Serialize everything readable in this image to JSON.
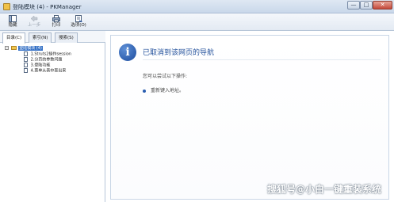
{
  "window": {
    "title": "登陆模块 (4) - PKManager",
    "minimize_glyph": "—",
    "maximize_glyph": "□",
    "close_glyph": "✕"
  },
  "toolbar": {
    "hide_label": "隐藏",
    "back_label": "上一步",
    "print_label": "打印",
    "options_label": "选项(O)"
  },
  "nav": {
    "tabs": [
      "目录(C)",
      "索引(N)",
      "搜索(S)"
    ],
    "tree": {
      "root_expander": "−",
      "root_label": "登陆模块 (4)",
      "children": [
        "1.Struts2操作session",
        "2.分页的参数问题",
        "3.登陆功能",
        "4.菜单从表中查出来"
      ]
    }
  },
  "content": {
    "info_glyph": "i",
    "heading": "已取消到该网页的导航",
    "suggest_label": "您可以尝试以下操作:",
    "suggest_item": "重新键入地址。"
  },
  "watermark": "搜狐号@小白一键重装系统",
  "colors": {
    "accent": "#1f4e9a",
    "selection": "#3470c5",
    "folder": "#f2c64d"
  },
  "icons": {
    "hide": "hide-pane-icon",
    "back": "back-arrow-icon",
    "print": "printer-icon",
    "options": "options-icon",
    "info": "info-icon"
  }
}
